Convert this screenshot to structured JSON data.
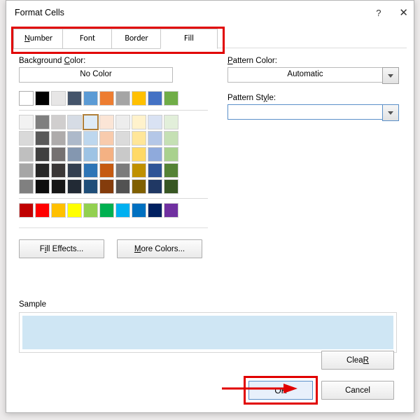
{
  "window": {
    "title": "Format Cells",
    "help_tooltip": "?",
    "close_tooltip": "✕"
  },
  "tabs": {
    "t1": {
      "label": "Number",
      "key": "N"
    },
    "t2": {
      "label": "Font"
    },
    "t3": {
      "label": "Border"
    },
    "t4": {
      "label": "Fill",
      "active": true
    }
  },
  "left": {
    "bg_label_pre": "Background ",
    "bg_label_key": "C",
    "bg_label_post": "olor:",
    "no_color": "No Color",
    "fill_effects_pre": "F",
    "fill_effects_key": "i",
    "fill_effects_post": "ll Effects...",
    "more_colors_key": "M",
    "more_colors_post": "ore Colors...",
    "palette": {
      "row_std": [
        "#ffffff",
        "#000000",
        "#e7e6e6",
        "#44546a",
        "#5b9bd5",
        "#ed7d31",
        "#a5a5a5",
        "#ffc000",
        "#4472c4",
        "#70ad47"
      ],
      "theme": [
        [
          "#f2f2f2",
          "#7f7f7f",
          "#d0cece",
          "#d6dce5",
          "#deebf7",
          "#fbe5d6",
          "#ededed",
          "#fff2cc",
          "#d9e2f3",
          "#e2efda"
        ],
        [
          "#d9d9d9",
          "#595959",
          "#aeabab",
          "#adb9ca",
          "#bdd7ee",
          "#f8cbad",
          "#dbdbdb",
          "#ffe699",
          "#b4c7e7",
          "#c5e0b4"
        ],
        [
          "#bfbfbf",
          "#404040",
          "#757171",
          "#8497b0",
          "#9dc3e4",
          "#f4b183",
          "#c9c9c9",
          "#ffd966",
          "#8faadc",
          "#a9d18e"
        ],
        [
          "#a6a6a6",
          "#262626",
          "#3b3838",
          "#333f50",
          "#2e75b6",
          "#c55a11",
          "#7b7b7b",
          "#bf9000",
          "#2f5597",
          "#548235"
        ],
        [
          "#808080",
          "#0d0d0d",
          "#171717",
          "#222a35",
          "#1f4e79",
          "#843c0c",
          "#525252",
          "#806000",
          "#203864",
          "#385723"
        ]
      ],
      "row_extra": [
        "#c00000",
        "#ff0000",
        "#ffc000",
        "#ffff00",
        "#92d050",
        "#00b050",
        "#00b0f0",
        "#0070c0",
        "#002060",
        "#7030a0"
      ],
      "selected_rc": [
        1,
        4
      ]
    }
  },
  "right": {
    "pat_color_key": "P",
    "pat_color_post": "attern Color:",
    "pat_color_value": "Automatic",
    "pat_style_pre": "Pattern St",
    "pat_style_key": "y",
    "pat_style_post": "le:"
  },
  "sample": {
    "label": "Sample",
    "color": "#cfe6f4"
  },
  "footer": {
    "clear_key": "R",
    "clear_pre": "Clea",
    "ok": "OK",
    "cancel": "Cancel"
  }
}
